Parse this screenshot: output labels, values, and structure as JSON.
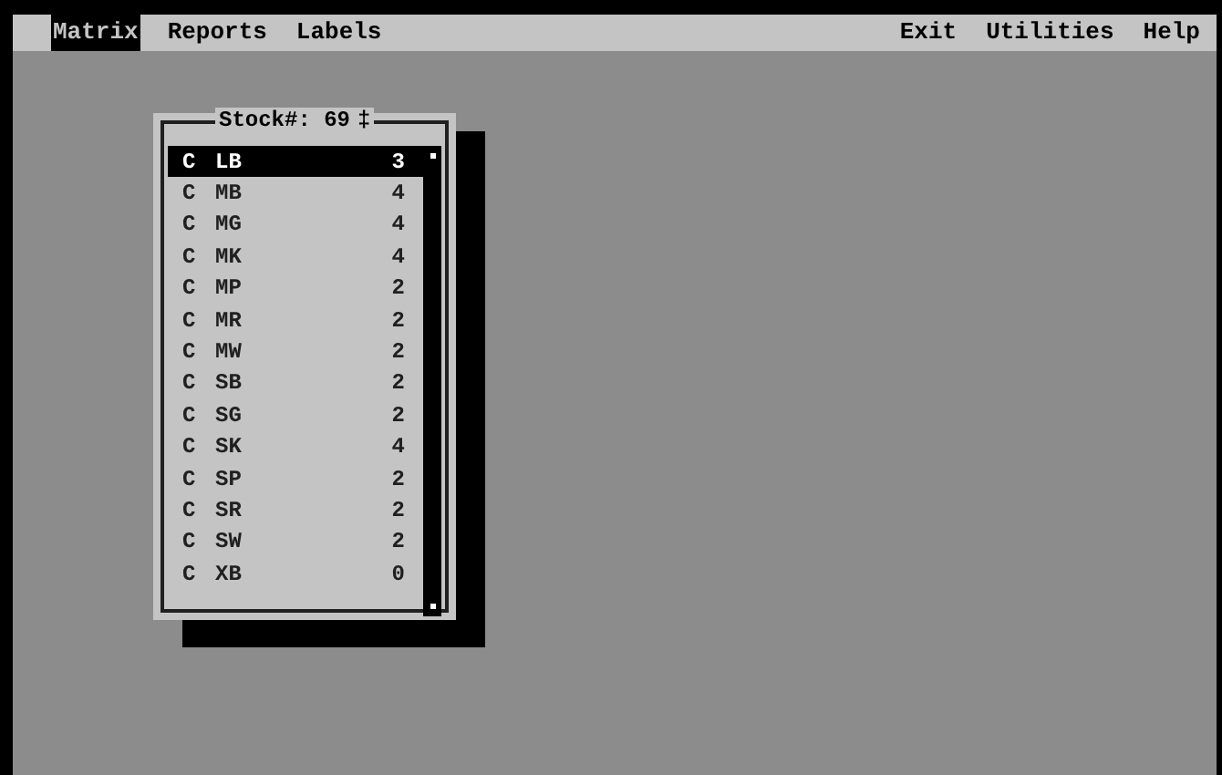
{
  "menu_left": [
    {
      "label": "Matrix",
      "selected": true
    },
    {
      "label": "Reports",
      "selected": false
    },
    {
      "label": "Labels",
      "selected": false
    }
  ],
  "menu_right": [
    {
      "label": "Exit",
      "selected": false
    },
    {
      "label": "Utilities",
      "selected": false
    },
    {
      "label": "Help",
      "selected": false
    }
  ],
  "dialog": {
    "title": "Stock#: 69",
    "indicator": "‡",
    "rows": [
      {
        "mark": "C",
        "code": "LB",
        "qty": "3",
        "selected": true
      },
      {
        "mark": "C",
        "code": "MB",
        "qty": "4",
        "selected": false
      },
      {
        "mark": "C",
        "code": "MG",
        "qty": "4",
        "selected": false
      },
      {
        "mark": "C",
        "code": "MK",
        "qty": "4",
        "selected": false
      },
      {
        "mark": "C",
        "code": "MP",
        "qty": "2",
        "selected": false
      },
      {
        "mark": "C",
        "code": "MR",
        "qty": "2",
        "selected": false
      },
      {
        "mark": "C",
        "code": "MW",
        "qty": "2",
        "selected": false
      },
      {
        "mark": "C",
        "code": "SB",
        "qty": "2",
        "selected": false
      },
      {
        "mark": "C",
        "code": "SG",
        "qty": "2",
        "selected": false
      },
      {
        "mark": "C",
        "code": "SK",
        "qty": "4",
        "selected": false
      },
      {
        "mark": "C",
        "code": "SP",
        "qty": "2",
        "selected": false
      },
      {
        "mark": "C",
        "code": "SR",
        "qty": "2",
        "selected": false
      },
      {
        "mark": "C",
        "code": "SW",
        "qty": "2",
        "selected": false
      },
      {
        "mark": "C",
        "code": "XB",
        "qty": "0",
        "selected": false
      }
    ]
  }
}
